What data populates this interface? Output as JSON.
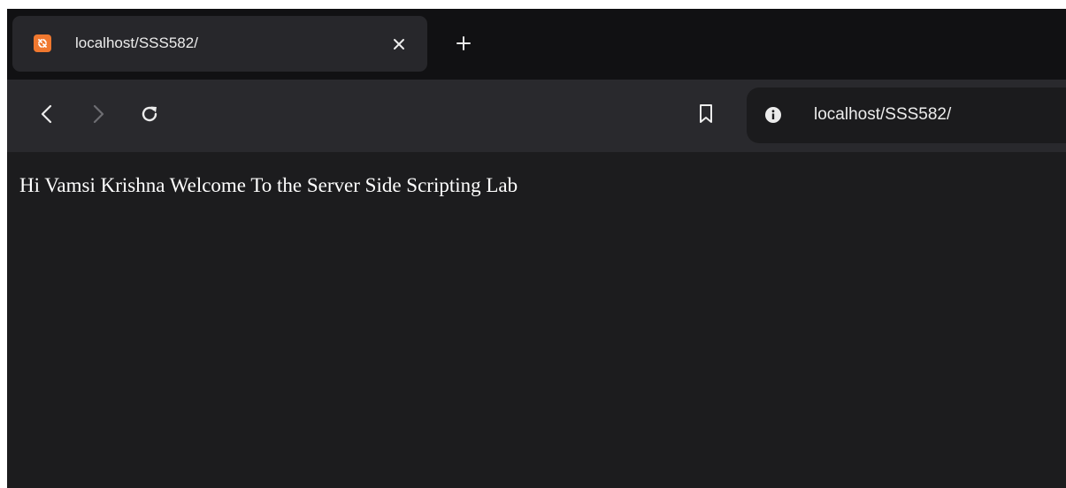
{
  "browser": {
    "tab": {
      "title": "localhost/SSS582/",
      "favicon": "xampp-icon",
      "close": "close-icon"
    },
    "new_tab": "plus-icon",
    "toolbar": {
      "back": "back-arrow-icon",
      "forward": "forward-arrow-icon",
      "reload": "reload-icon",
      "bookmark": "bookmark-icon",
      "site_info": "info-icon",
      "url": "localhost/SSS582/"
    },
    "colors": {
      "tabstrip": "#111113",
      "active_tab": "#27272b",
      "toolbar": "#29292d",
      "omnibox": "#1b1b1d",
      "page_bg": "#1c1c1e",
      "favicon": "#f0782f"
    }
  },
  "page": {
    "text": "Hi Vamsi Krishna Welcome To the Server Side Scripting Lab"
  }
}
